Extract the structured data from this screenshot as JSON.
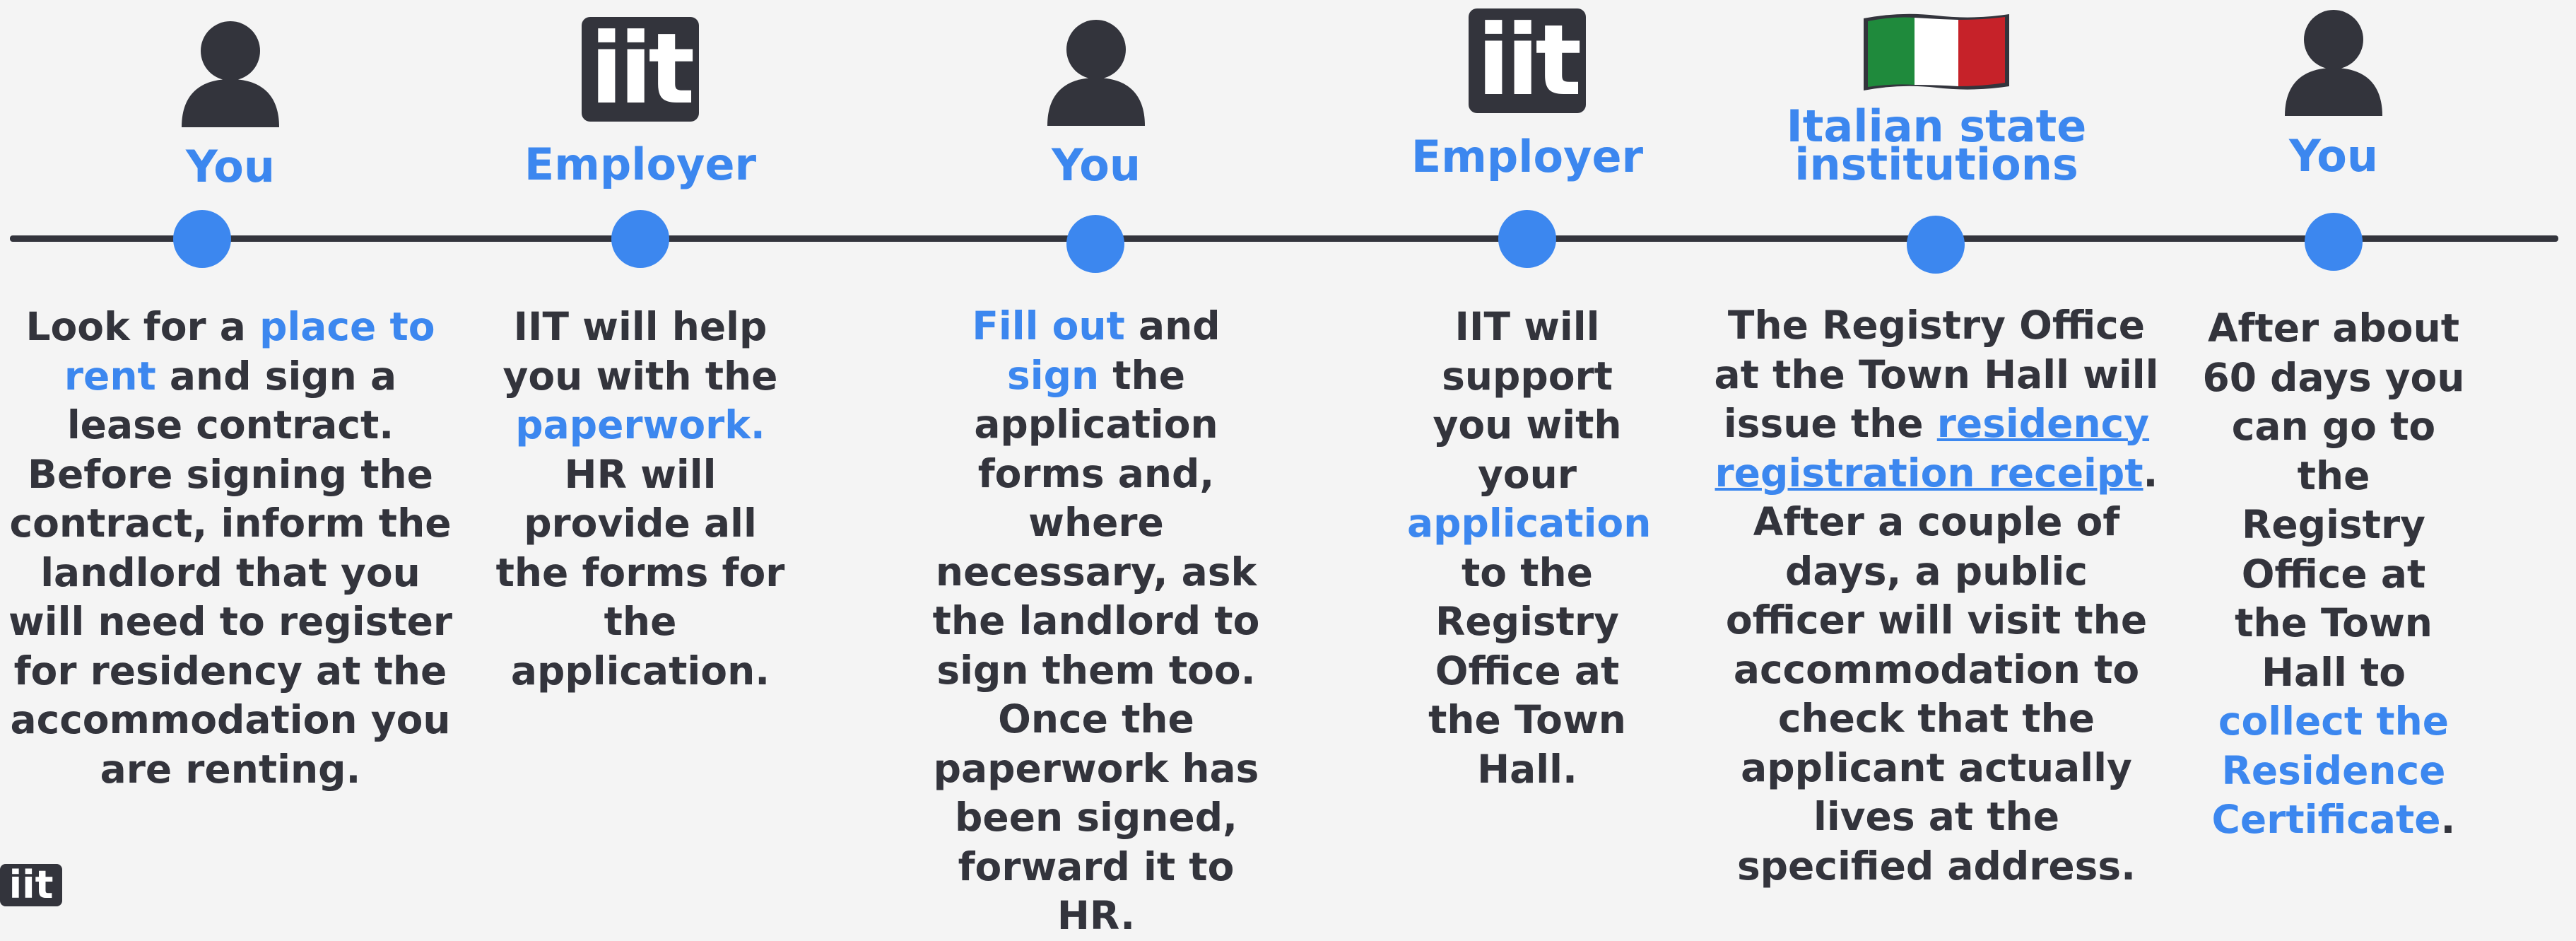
{
  "steps": [
    {
      "role": "You",
      "icon": "person-icon",
      "desc": [
        {
          "t": "Look for a ",
          "s": "n"
        },
        {
          "t": "place to rent",
          "s": "hl"
        },
        {
          "t": " and sign a lease contract. Before signing the contract, inform the landlord that you will need to register for residency at the accommodation you are renting.",
          "s": "n"
        }
      ]
    },
    {
      "role": "Employer",
      "icon": "iit-logo-icon",
      "logo_text": "iit",
      "desc": [
        {
          "t": "IIT will help you with the ",
          "s": "n"
        },
        {
          "t": "paperwork.",
          "s": "hl"
        },
        {
          "t": " HR will provide all the forms for the application.",
          "s": "n"
        }
      ]
    },
    {
      "role": "You",
      "icon": "person-icon",
      "desc": [
        {
          "t": "Fill out",
          "s": "hl"
        },
        {
          "t": " and ",
          "s": "n"
        },
        {
          "t": "sign",
          "s": "hl"
        },
        {
          "t": " the application forms and, where necessary, ask the landlord to sign them too. Once the paperwork has been signed, forward it to HR.",
          "s": "n"
        }
      ]
    },
    {
      "role": "Employer",
      "icon": "iit-logo-icon",
      "logo_text": "iit",
      "desc": [
        {
          "t": "IIT will support you with your ",
          "s": "n"
        },
        {
          "t": "application",
          "s": "hl"
        },
        {
          "t": " to the Registry Office at the Town Hall.",
          "s": "n"
        }
      ]
    },
    {
      "role": "Italian state institutions",
      "icon": "italian-flag-icon",
      "desc": [
        {
          "t": "The Registry Office at the Town Hall will issue the ",
          "s": "n"
        },
        {
          "t": "residency registration receipt",
          "s": "ul"
        },
        {
          "t": ". After a couple of days, a public officer will visit the accommodation to check that the applicant actually lives at the specified address.",
          "s": "n"
        }
      ]
    },
    {
      "role": "You",
      "icon": "person-icon",
      "desc": [
        {
          "t": "After about 60 days you can go to the Registry Office at the Town Hall to ",
          "s": "n"
        },
        {
          "t": "collect the Residence Certificate",
          "s": "hl"
        },
        {
          "t": ".",
          "s": "n"
        }
      ]
    }
  ],
  "corner_logo_text": "iit",
  "colors": {
    "accent": "#3c87ef",
    "dark": "#33343c",
    "background": "#f4f4f4",
    "flag_green": "#1f8a3c",
    "flag_red": "#c62229"
  }
}
